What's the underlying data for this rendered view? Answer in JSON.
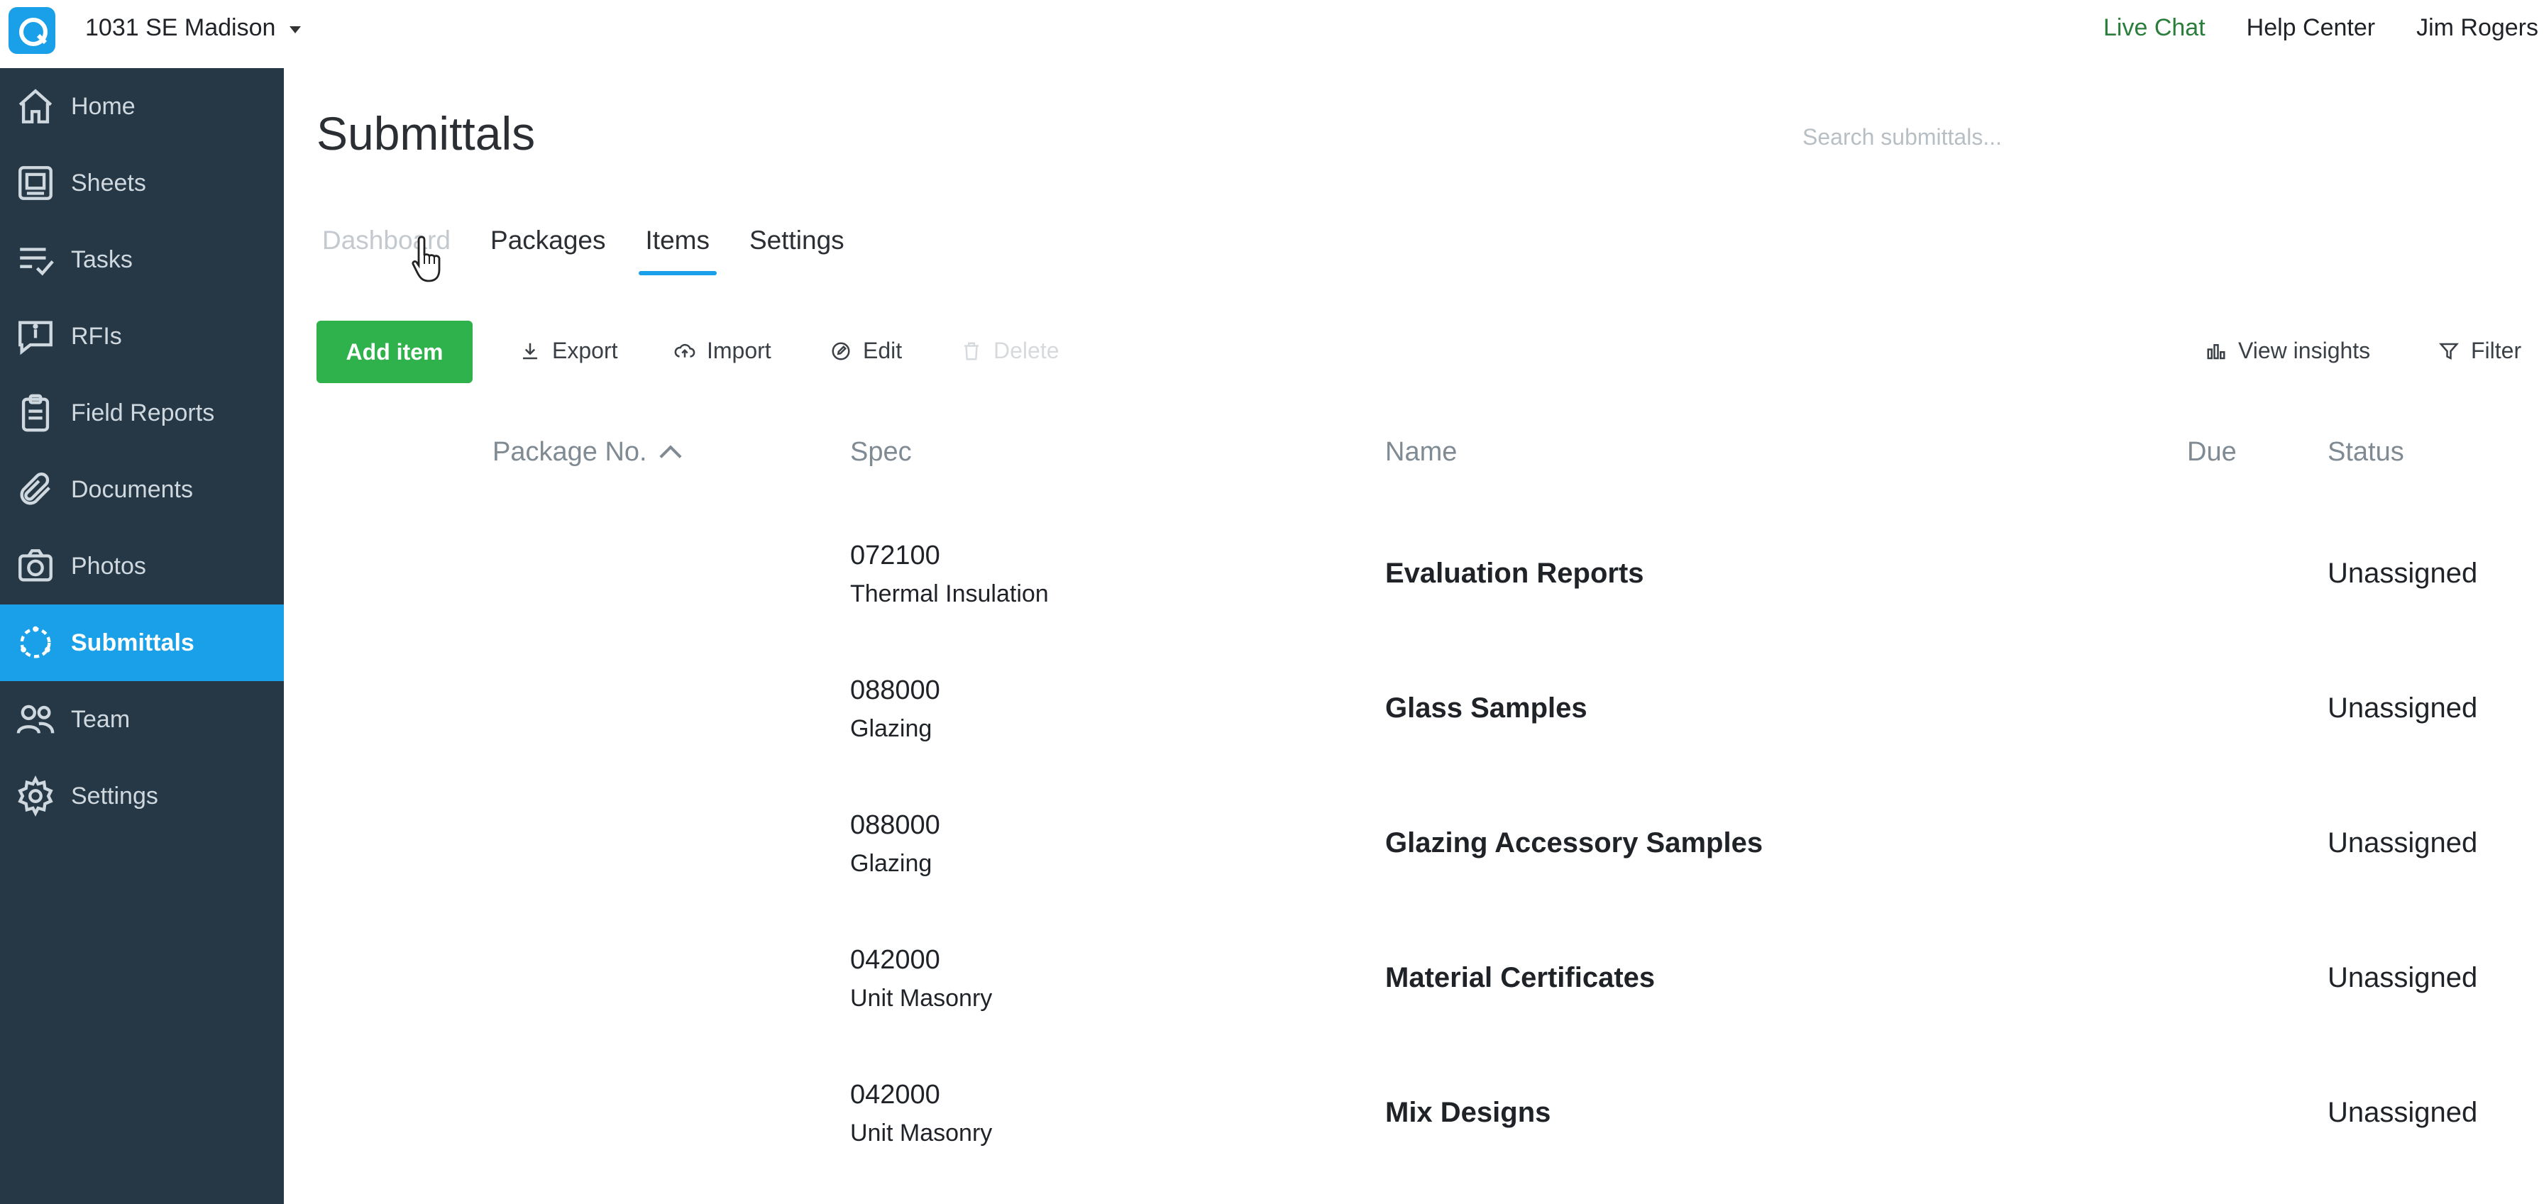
{
  "header": {
    "project_name": "1031 SE Madison",
    "live_chat": "Live Chat",
    "help_center": "Help Center",
    "user_name": "Jim Rogers"
  },
  "sidebar": {
    "items": [
      {
        "label": "Home",
        "icon": "home-icon"
      },
      {
        "label": "Sheets",
        "icon": "sheets-icon"
      },
      {
        "label": "Tasks",
        "icon": "tasks-icon"
      },
      {
        "label": "RFIs",
        "icon": "rfi-icon"
      },
      {
        "label": "Field Reports",
        "icon": "clipboard-icon"
      },
      {
        "label": "Documents",
        "icon": "paperclip-icon"
      },
      {
        "label": "Photos",
        "icon": "camera-icon"
      },
      {
        "label": "Submittals",
        "icon": "submittals-icon",
        "active": true
      },
      {
        "label": "Team",
        "icon": "team-icon"
      },
      {
        "label": "Settings",
        "icon": "gear-icon"
      }
    ]
  },
  "page": {
    "title": "Submittals",
    "search_placeholder": "Search submittals..."
  },
  "tabs": [
    {
      "label": "Dashboard",
      "state": "hover"
    },
    {
      "label": "Packages"
    },
    {
      "label": "Items",
      "state": "active"
    },
    {
      "label": "Settings"
    }
  ],
  "toolbar": {
    "add_item": "Add item",
    "export": "Export",
    "import": "Import",
    "edit": "Edit",
    "delete": "Delete",
    "view_insights": "View insights",
    "filter": "Filter"
  },
  "table": {
    "columns": [
      "Package No.",
      "Spec",
      "Name",
      "Due",
      "Status"
    ],
    "rows": [
      {
        "spec_code": "072100",
        "spec_name": "Thermal Insulation",
        "name": "Evaluation Reports",
        "due": "",
        "status": "Unassigned"
      },
      {
        "spec_code": "088000",
        "spec_name": "Glazing",
        "name": "Glass Samples",
        "due": "",
        "status": "Unassigned"
      },
      {
        "spec_code": "088000",
        "spec_name": "Glazing",
        "name": "Glazing Accessory Samples",
        "due": "",
        "status": "Unassigned"
      },
      {
        "spec_code": "042000",
        "spec_name": "Unit Masonry",
        "name": "Material Certificates",
        "due": "",
        "status": "Unassigned"
      },
      {
        "spec_code": "042000",
        "spec_name": "Unit Masonry",
        "name": "Mix Designs",
        "due": "",
        "status": "Unassigned"
      }
    ]
  },
  "colors": {
    "sidebar_bg": "#263846",
    "accent": "#1aa0e8",
    "add_button": "#2fb24c",
    "live_chat": "#2a7d3a"
  }
}
